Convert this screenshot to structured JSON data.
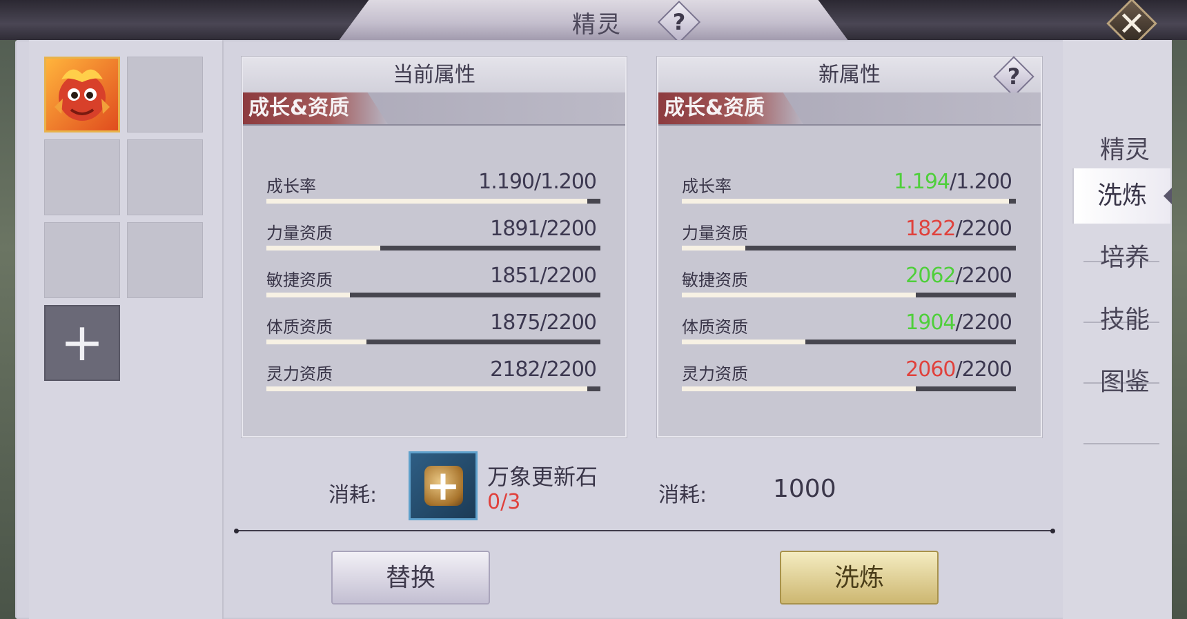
{
  "window": {
    "title": "精灵"
  },
  "left_slots": {
    "add_symbol": "+"
  },
  "current": {
    "header": "当前属性",
    "section": "成长&资质",
    "stats": [
      {
        "label": "成长率",
        "value": "1.190",
        "max": "1.200",
        "fill_fraction": 0.96
      },
      {
        "label": "力量资质",
        "value": "1891",
        "max": "2200",
        "fill_fraction": 0.34
      },
      {
        "label": "敏捷资质",
        "value": "1851",
        "max": "2200",
        "fill_fraction": 0.25
      },
      {
        "label": "体质资质",
        "value": "1875",
        "max": "2200",
        "fill_fraction": 0.3
      },
      {
        "label": "灵力资质",
        "value": "2182",
        "max": "2200",
        "fill_fraction": 0.96
      }
    ]
  },
  "new": {
    "header": "新属性",
    "help": "?",
    "section": "成长&资质",
    "stats": [
      {
        "label": "成长率",
        "value": "1.194",
        "max": "1.200",
        "trend": "up",
        "fill_fraction": 0.98
      },
      {
        "label": "力量资质",
        "value": "1822",
        "max": "2200",
        "trend": "down",
        "fill_fraction": 0.19
      },
      {
        "label": "敏捷资质",
        "value": "2062",
        "max": "2200",
        "trend": "up",
        "fill_fraction": 0.7
      },
      {
        "label": "体质资质",
        "value": "1904",
        "max": "2200",
        "trend": "up",
        "fill_fraction": 0.37
      },
      {
        "label": "灵力资质",
        "value": "2060",
        "max": "2200",
        "trend": "down",
        "fill_fraction": 0.7
      }
    ]
  },
  "cost": {
    "label": "消耗:",
    "item_name": "万象更新石",
    "item_count": "0/3",
    "gold_label": "消耗:",
    "gold_amount": "1000"
  },
  "buttons": {
    "replace": "替换",
    "wash": "洗炼"
  },
  "nav": [
    "精灵",
    "洗炼",
    "培养",
    "技能",
    "图鉴"
  ],
  "colors": {
    "up": "#4fcf3b",
    "down": "#e0413c",
    "normal": "#3c3850",
    "count_red": "#e0413c"
  },
  "icons": [
    "help-icon",
    "close-icon",
    "plus-icon",
    "pet-avatar",
    "stone-item-icon"
  ]
}
